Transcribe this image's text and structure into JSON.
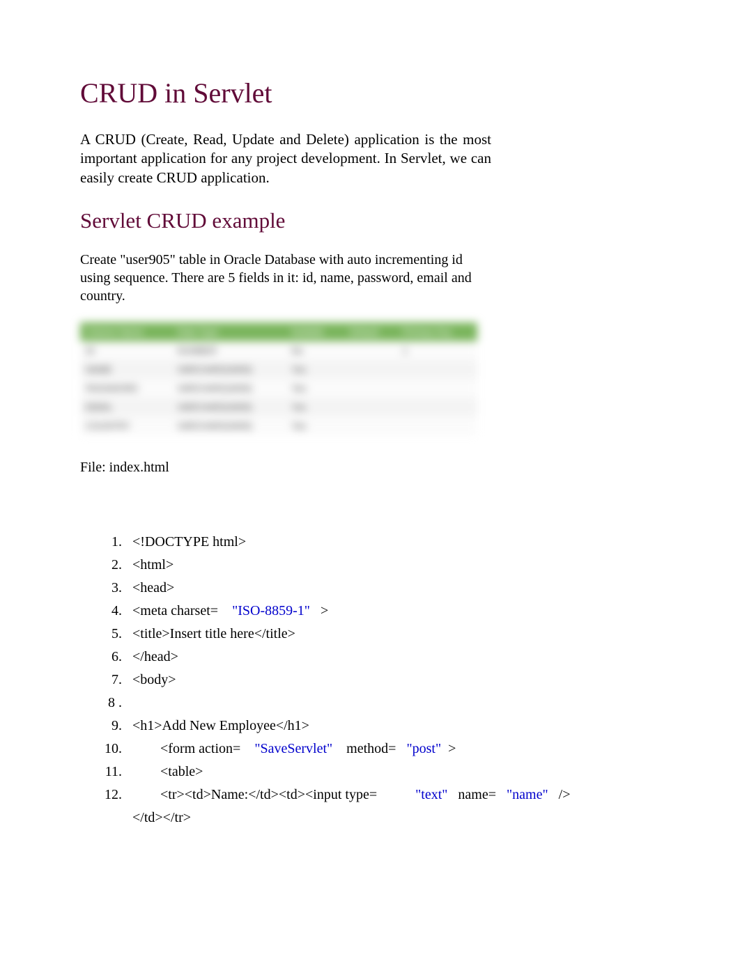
{
  "title": "CRUD in Servlet",
  "lead": "A CRUD (Create, Read, Update and Delete) application is the most important application for any project development. In Servlet, we can easily create CRUD application.",
  "subtitle": "Servlet CRUD example",
  "para": "Create \"user905\" table in Oracle Database with auto incrementing id using sequence. There are 5 fields in it: id, name, password, email and country.",
  "schema_headers": [
    "Column Name",
    "Data Type",
    "Nullable",
    "Default",
    "Primary Key"
  ],
  "schema_rows": [
    [
      "ID",
      "NUMBER",
      "No",
      "",
      "1"
    ],
    [
      "NAME",
      "VARCHAR2(4000)",
      "Yes",
      "",
      ""
    ],
    [
      "PASSWORD",
      "VARCHAR2(4000)",
      "Yes",
      "",
      ""
    ],
    [
      "EMAIL",
      "VARCHAR2(4000)",
      "Yes",
      "",
      ""
    ],
    [
      "COUNTRY",
      "VARCHAR2(4000)",
      "Yes",
      "",
      ""
    ]
  ],
  "file_caption": "File: index.html",
  "code": {
    "l1": "<!DOCTYPE html>",
    "l2": "<html>",
    "l3": "<head>",
    "l4a": "<meta charset=",
    "l4b": "\"ISO-8859-1\"",
    "l4c": ">",
    "l5": "<title>Insert title here</title>",
    "l6": "</head>",
    "l7": "<body>",
    "l8": "",
    "l9": "<h1>Add New Employee</h1>",
    "l10a": "<form action=",
    "l10b": "\"SaveServlet\"",
    "l10c": " method=",
    "l10d": "\"post\"",
    "l10e": ">",
    "l11": "<table>",
    "l12a": "<tr><td>Name:</td><td><input type=",
    "l12b": "\"text\"",
    "l12c": " name=",
    "l12d": "\"name\"",
    "l12e": "/>",
    "l12f": "</td></tr>"
  },
  "line_numbers": {
    "n1": "1.",
    "n2": "2.",
    "n3": "3.",
    "n4": "4.",
    "n5": "5.",
    "n6": "6.",
    "n7": "7.",
    "n8": "8 .",
    "n9": "9.",
    "n10": "10.",
    "n11": "11.",
    "n12": "12."
  }
}
